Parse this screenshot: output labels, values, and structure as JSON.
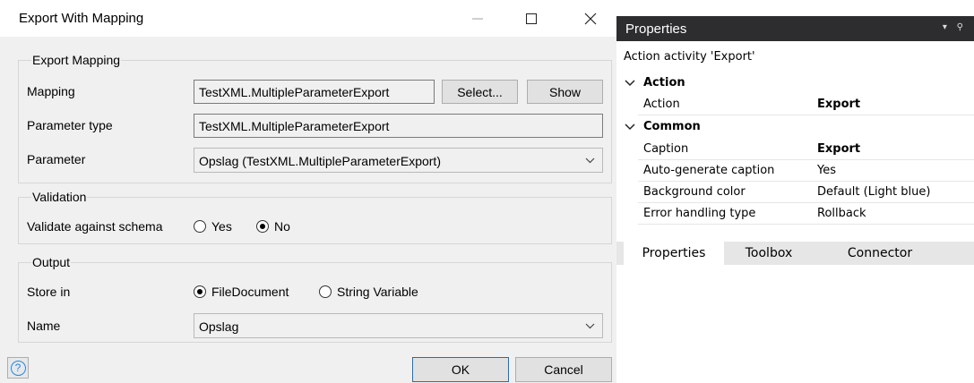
{
  "dialog": {
    "title": "Export With Mapping",
    "export_mapping": {
      "group_label": "Export Mapping",
      "mapping_label": "Mapping",
      "mapping_value": "TestXML.MultipleParameterExport",
      "select_button": "Select...",
      "show_button": "Show",
      "parameter_type_label": "Parameter type",
      "parameter_type_value": "TestXML.MultipleParameterExport",
      "parameter_label": "Parameter",
      "parameter_value": "Opslag (TestXML.MultipleParameterExport)"
    },
    "validation": {
      "group_label": "Validation",
      "validate_label": "Validate against schema",
      "option_yes": "Yes",
      "option_no": "No",
      "selected": "No"
    },
    "output": {
      "group_label": "Output",
      "store_in_label": "Store in",
      "option_file": "FileDocument",
      "option_string": "String Variable",
      "selected": "FileDocument",
      "name_label": "Name",
      "name_value": "Opslag"
    },
    "ok_button": "OK",
    "cancel_button": "Cancel",
    "help_icon": "?"
  },
  "properties": {
    "title": "Properties",
    "activity": "Action activity 'Export'",
    "sections": [
      {
        "name": "Action",
        "rows": [
          {
            "key": "Action",
            "value": "Export",
            "bold": true
          }
        ]
      },
      {
        "name": "Common",
        "rows": [
          {
            "key": "Caption",
            "value": "Export",
            "bold": true
          },
          {
            "key": "Auto-generate caption",
            "value": "Yes"
          },
          {
            "key": "Background color",
            "value": "Default (Light blue)"
          },
          {
            "key": "Error handling type",
            "value": "Rollback"
          }
        ]
      }
    ],
    "tabs": [
      "Properties",
      "Toolbox",
      "Connector"
    ],
    "active_tab": "Properties"
  },
  "colors": {
    "panel_header": "#2d2d30",
    "dialog_body": "#f0f0f0",
    "accent": "#0078d7"
  }
}
